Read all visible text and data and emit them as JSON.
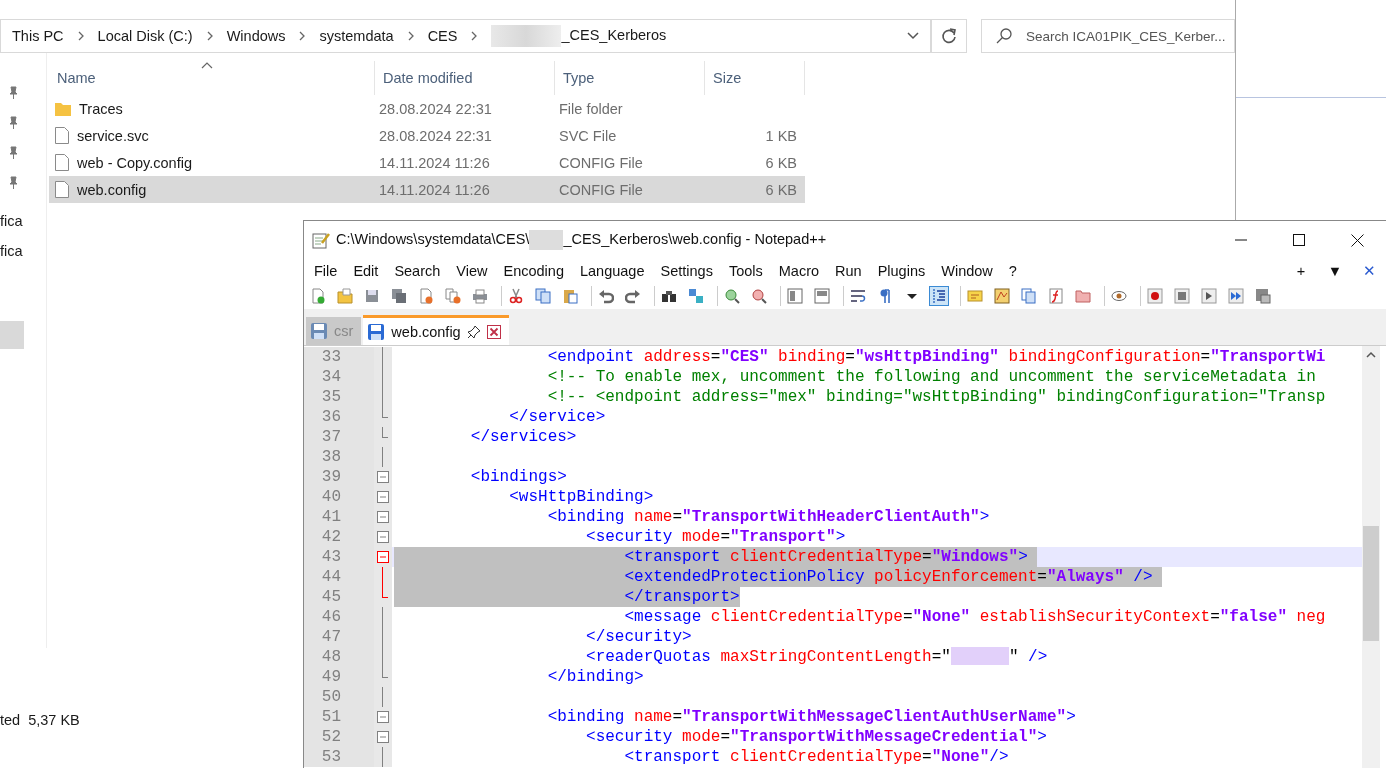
{
  "explorer": {
    "breadcrumb": [
      {
        "label": "This PC",
        "redacted_prefix": false
      },
      {
        "label": "Local Disk (C:)",
        "redacted_prefix": false
      },
      {
        "label": "Windows",
        "redacted_prefix": false
      },
      {
        "label": "systemdata",
        "redacted_prefix": false
      },
      {
        "label": "CES",
        "redacted_prefix": false
      },
      {
        "label": "_CES_Kerberos",
        "redacted_prefix": true
      }
    ],
    "search": {
      "placeholder": "Search ICA01PIK_CES_Kerber..."
    },
    "nav_items": [
      {
        "label": "fica",
        "selected": false
      },
      {
        "label": "fica",
        "selected": false
      },
      {
        "selected": true
      }
    ],
    "columns": [
      "Name",
      "Date modified",
      "Type",
      "Size"
    ],
    "rows": [
      {
        "kind": "folder",
        "name": "Traces",
        "date": "28.08.2024 22:31",
        "type": "File folder",
        "selected": false
      },
      {
        "kind": "file",
        "name": "service.svc",
        "date": "28.08.2024 22:31",
        "type": "SVC File",
        "size": "1 KB",
        "selected": false
      },
      {
        "kind": "file",
        "name": "web - Copy.config",
        "date": "14.11.2024 11:26",
        "type": "CONFIG File",
        "size": "6 KB",
        "selected": false
      },
      {
        "kind": "file",
        "name": "web.config",
        "date": "14.11.2024 11:26",
        "type": "CONFIG File",
        "size": "6 KB",
        "selected": true
      }
    ],
    "status_bar": [
      "ted",
      "5,37 KB"
    ]
  },
  "notepad": {
    "title_start": "C:\\Windows\\systemdata\\CES\\",
    "title_end": "_CES_Kerberos\\web.config - Notepad++",
    "menu": [
      "File",
      "Edit",
      "Search",
      "View",
      "Encoding",
      "Language",
      "Settings",
      "Tools",
      "Macro",
      "Run",
      "Plugins",
      "Window",
      "?"
    ],
    "menu_right": [
      "+",
      "▼",
      "✕"
    ],
    "toolbar_groups": [
      [
        {
          "kind": "new",
          "pressed": false
        },
        {
          "kind": "open",
          "pressed": false
        },
        {
          "kind": "save",
          "pressed": false
        },
        {
          "kind": "save-all",
          "pressed": false
        },
        {
          "kind": "close",
          "pressed": false
        },
        {
          "kind": "close-all",
          "pressed": false
        },
        {
          "kind": "print",
          "pressed": false
        }
      ],
      [
        {
          "kind": "cut",
          "pressed": false
        },
        {
          "kind": "copy",
          "pressed": false
        },
        {
          "kind": "paste",
          "pressed": false
        }
      ],
      [
        {
          "kind": "undo",
          "pressed": false
        },
        {
          "kind": "redo",
          "pressed": false
        }
      ],
      [
        {
          "kind": "find",
          "pressed": false
        },
        {
          "kind": "replace",
          "pressed": false
        }
      ],
      [
        {
          "kind": "zoom-in",
          "pressed": false
        },
        {
          "kind": "zoom-out",
          "pressed": false
        }
      ],
      [
        {
          "kind": "sync-v",
          "pressed": false
        },
        {
          "kind": "sync-h",
          "pressed": false
        }
      ],
      [
        {
          "kind": "wrap",
          "pressed": false
        },
        {
          "kind": "pilcrow",
          "pressed": false
        },
        {
          "kind": "dropdown",
          "pressed": false
        },
        {
          "kind": "indent",
          "pressed": true
        }
      ],
      [
        {
          "kind": "udl",
          "pressed": false
        },
        {
          "kind": "docmap",
          "pressed": false
        },
        {
          "kind": "doclist",
          "pressed": false
        },
        {
          "kind": "funclist",
          "pressed": false
        },
        {
          "kind": "folder",
          "pressed": false
        }
      ],
      [
        {
          "kind": "monitor",
          "pressed": false
        }
      ],
      [
        {
          "kind": "record",
          "pressed": false
        },
        {
          "kind": "stop",
          "pressed": false
        },
        {
          "kind": "play",
          "pressed": false
        },
        {
          "kind": "play-multi",
          "pressed": false
        },
        {
          "kind": "save-macro",
          "pressed": false
        }
      ]
    ],
    "tabs": [
      {
        "label": "csr",
        "selected": false
      },
      {
        "label": "web.config",
        "selected": true
      }
    ],
    "lines": [
      {
        "number": "33",
        "kind": "line",
        "selected": false,
        "current": false,
        "segments": [
          {
            "kind": "tag",
            "text": "                <endpoint "
          },
          {
            "kind": "attr",
            "text": "address"
          },
          {
            "kind": "plain",
            "text": "="
          },
          {
            "kind": "value",
            "text": "\"CES\""
          },
          {
            "kind": "attr",
            "text": " binding"
          },
          {
            "kind": "plain",
            "text": "="
          },
          {
            "kind": "value",
            "text": "\"wsHttpBinding\""
          },
          {
            "kind": "attr",
            "text": " bindingConfiguration"
          },
          {
            "kind": "plain",
            "text": "="
          },
          {
            "kind": "value",
            "text": "\"TransportWi"
          }
        ]
      },
      {
        "number": "34",
        "kind": "line",
        "selected": false,
        "current": false,
        "segments": [
          {
            "kind": "comment",
            "text": "                <!-- To enable mex, uncomment the following and uncomment the serviceMetadata in"
          }
        ]
      },
      {
        "number": "35",
        "kind": "line",
        "selected": false,
        "current": false,
        "segments": [
          {
            "kind": "comment",
            "text": "                <!-- <endpoint address=\"mex\" binding=\"wsHttpBinding\" bindingConfiguration=\"Transp"
          }
        ]
      },
      {
        "number": "36",
        "kind": "end",
        "selected": false,
        "current": false,
        "segments": [
          {
            "kind": "tag",
            "text": "            </service>"
          }
        ]
      },
      {
        "number": "37",
        "kind": "end",
        "selected": false,
        "current": false,
        "segments": [
          {
            "kind": "tag",
            "text": "        </services>"
          }
        ]
      },
      {
        "number": "38",
        "kind": "line",
        "selected": false,
        "current": false
      },
      {
        "number": "39",
        "kind": "box",
        "selected": false,
        "current": false,
        "segments": [
          {
            "kind": "tag",
            "text": "        <bindings>"
          }
        ]
      },
      {
        "number": "40",
        "kind": "box",
        "selected": false,
        "current": false,
        "segments": [
          {
            "kind": "tag",
            "text": "            <wsHttpBinding>"
          }
        ]
      },
      {
        "number": "41",
        "kind": "box",
        "selected": false,
        "current": false,
        "segments": [
          {
            "kind": "tag",
            "text": "                <binding "
          },
          {
            "kind": "attr",
            "text": "name"
          },
          {
            "kind": "plain",
            "text": "="
          },
          {
            "kind": "value",
            "text": "\"TransportWithHeaderClientAuth\""
          },
          {
            "kind": "tag",
            "text": ">"
          }
        ]
      },
      {
        "number": "42",
        "kind": "box",
        "selected": false,
        "current": false,
        "segments": [
          {
            "kind": "tag",
            "text": "                    <security "
          },
          {
            "kind": "attr",
            "text": "mode"
          },
          {
            "kind": "plain",
            "text": "="
          },
          {
            "kind": "value",
            "text": "\"Transport\""
          },
          {
            "kind": "tag",
            "text": ">"
          }
        ]
      },
      {
        "number": "43",
        "kind": "box",
        "selected": true,
        "current": true,
        "segments": [
          {
            "kind": "tag",
            "text": "                        <transport "
          },
          {
            "kind": "attr",
            "text": "clientCredentialType"
          },
          {
            "kind": "plain",
            "text": "="
          },
          {
            "kind": "value",
            "text": "\"Windows\""
          },
          {
            "kind": "tag",
            "text": "> "
          }
        ]
      },
      {
        "number": "44",
        "kind": "line",
        "selected": true,
        "current": false,
        "segments": [
          {
            "kind": "tag",
            "text": "                        <extendedProtectionPolicy "
          },
          {
            "kind": "attr",
            "text": "policyEnforcement"
          },
          {
            "kind": "plain",
            "text": "="
          },
          {
            "kind": "value",
            "text": "\"Always\""
          },
          {
            "kind": "tag",
            "text": " /> "
          }
        ]
      },
      {
        "number": "45",
        "kind": "end",
        "selected": true,
        "current": false,
        "segments": [
          {
            "kind": "tag",
            "text": "                        </transport>"
          }
        ]
      },
      {
        "number": "46",
        "kind": "line",
        "selected": false,
        "current": false,
        "segments": [
          {
            "kind": "tag",
            "text": "                        <message "
          },
          {
            "kind": "attr",
            "text": "clientCredentialType"
          },
          {
            "kind": "plain",
            "text": "="
          },
          {
            "kind": "value",
            "text": "\"None\""
          },
          {
            "kind": "attr",
            "text": " establishSecurityContext"
          },
          {
            "kind": "plain",
            "text": "="
          },
          {
            "kind": "value",
            "text": "\"false\""
          },
          {
            "kind": "attr",
            "text": " neg"
          }
        ]
      },
      {
        "number": "47",
        "kind": "line",
        "selected": false,
        "current": false,
        "segments": [
          {
            "kind": "tag",
            "text": "                    </security>"
          }
        ]
      },
      {
        "number": "48",
        "kind": "line",
        "selected": false,
        "current": false,
        "segments": [
          {
            "kind": "tag",
            "text": "                    <readerQuotas "
          },
          {
            "kind": "attr",
            "text": "maxStringContentLength"
          },
          {
            "kind": "plain",
            "text": "=\""
          },
          {
            "kind": "redacted"
          },
          {
            "kind": "plain",
            "text": "\""
          },
          {
            "kind": "tag",
            "text": " />"
          }
        ]
      },
      {
        "number": "49",
        "kind": "end",
        "selected": false,
        "current": false,
        "segments": [
          {
            "kind": "tag",
            "text": "                </binding>"
          }
        ]
      },
      {
        "number": "50",
        "kind": "line",
        "selected": false,
        "current": false
      },
      {
        "number": "51",
        "kind": "box",
        "selected": false,
        "current": false,
        "segments": [
          {
            "kind": "tag",
            "text": "                <binding "
          },
          {
            "kind": "attr",
            "text": "name"
          },
          {
            "kind": "plain",
            "text": "="
          },
          {
            "kind": "value",
            "text": "\"TransportWithMessageClientAuthUserName\""
          },
          {
            "kind": "tag",
            "text": ">"
          }
        ]
      },
      {
        "number": "52",
        "kind": "box",
        "selected": false,
        "current": false,
        "segments": [
          {
            "kind": "tag",
            "text": "                    <security "
          },
          {
            "kind": "attr",
            "text": "mode"
          },
          {
            "kind": "plain",
            "text": "="
          },
          {
            "kind": "value",
            "text": "\"TransportWithMessageCredential\""
          },
          {
            "kind": "tag",
            "text": ">"
          }
        ]
      },
      {
        "number": "53",
        "kind": "line",
        "selected": false,
        "current": false,
        "segments": [
          {
            "kind": "tag",
            "text": "                        <transport "
          },
          {
            "kind": "attr",
            "text": "clientCredentialType"
          },
          {
            "kind": "plain",
            "text": "="
          },
          {
            "kind": "value",
            "text": "\"None\""
          },
          {
            "kind": "tag",
            "text": "/>"
          }
        ]
      }
    ]
  }
}
